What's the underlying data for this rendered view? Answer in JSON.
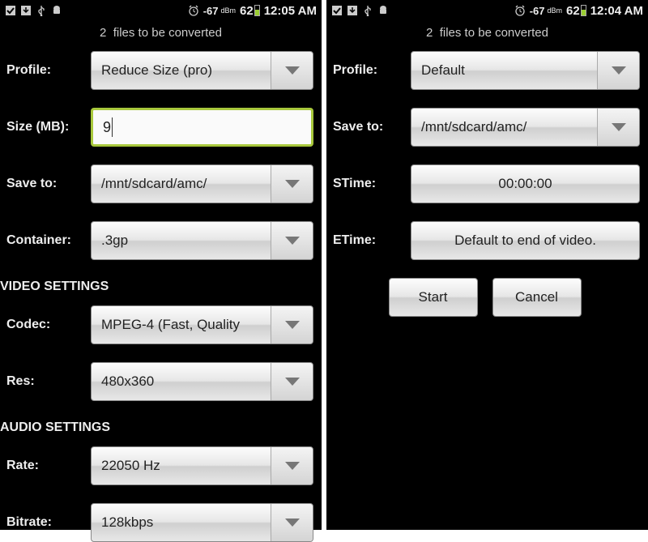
{
  "left": {
    "status": {
      "signal": "-67",
      "signal_unit": "dBm",
      "battery": "62",
      "time": "12:05 AM"
    },
    "caption_count": "2",
    "caption_text": "files to be converted",
    "rows": {
      "profile_label": "Profile:",
      "profile_value": "Reduce Size (pro)",
      "size_label": "Size (MB):",
      "size_value": "9",
      "saveto_label": "Save to:",
      "saveto_value": "/mnt/sdcard/amc/",
      "container_label": "Container:",
      "container_value": ".3gp"
    },
    "video_section": "VIDEO SETTINGS",
    "video": {
      "codec_label": "Codec:",
      "codec_value": "MPEG-4 (Fast, Quality",
      "res_label": "Res:",
      "res_value": "480x360"
    },
    "audio_section": "AUDIO SETTINGS",
    "audio": {
      "rate_label": "Rate:",
      "rate_value": "22050 Hz",
      "bitrate_label": "Bitrate:",
      "bitrate_value": "128kbps"
    }
  },
  "right": {
    "status": {
      "signal": "-67",
      "signal_unit": "dBm",
      "battery": "62",
      "time": "12:04 AM"
    },
    "caption_count": "2",
    "caption_text": "files to be converted",
    "rows": {
      "profile_label": "Profile:",
      "profile_value": "Default",
      "saveto_label": "Save to:",
      "saveto_value": "/mnt/sdcard/amc/",
      "stime_label": "STime:",
      "stime_value": "00:00:00",
      "etime_label": "ETime:",
      "etime_value": "Default to end of video."
    },
    "buttons": {
      "start": "Start",
      "cancel": "Cancel"
    }
  }
}
